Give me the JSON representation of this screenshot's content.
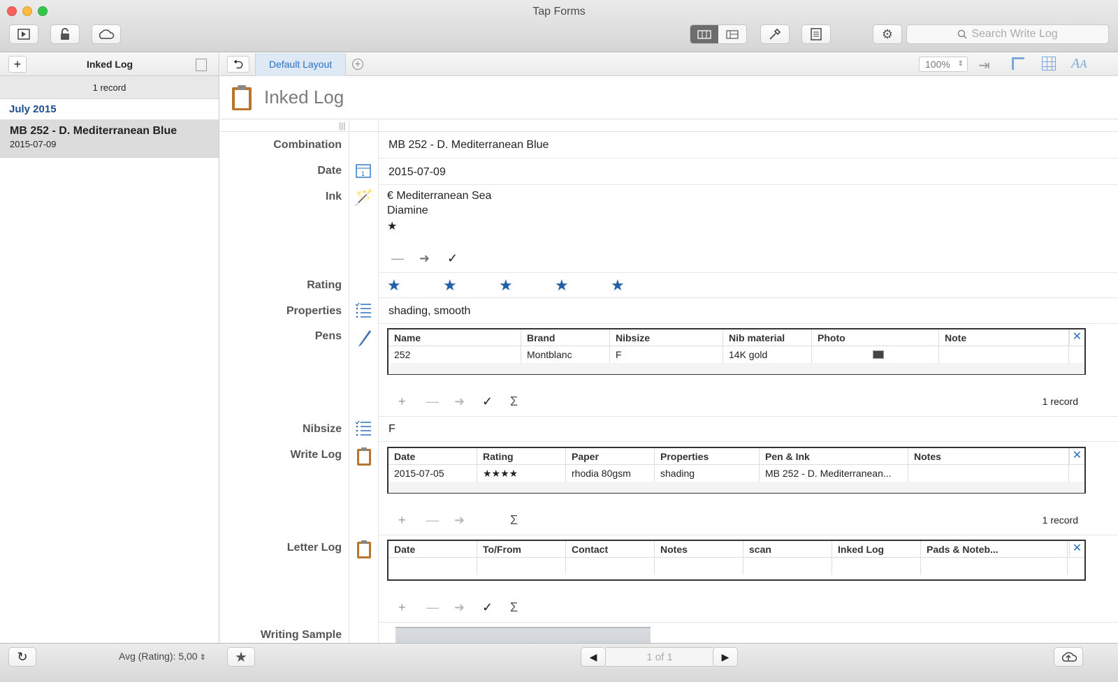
{
  "window": {
    "title": "Tap Forms",
    "search_placeholder": "Search Write Log"
  },
  "sidebar": {
    "title": "Inked Log",
    "record_count": "1 record",
    "group": "July 2015",
    "record": {
      "title": "MB 252 - D. Mediterranean Blue",
      "date": "2015-07-09"
    },
    "footer": "Avg (Rating): 5,00"
  },
  "main": {
    "layout_tab": "Default Layout",
    "zoom": "100%",
    "form_title": "Inked Log",
    "fields": {
      "combination": {
        "label": "Combination",
        "value": "MB 252 - D. Mediterranean Blue"
      },
      "date": {
        "label": "Date",
        "value": "2015-07-09"
      },
      "ink": {
        "label": "Ink",
        "line1": "€ Mediterranean Sea",
        "line2": "Diamine",
        "line3": "★"
      },
      "rating": {
        "label": "Rating",
        "value": 5,
        "max": 5
      },
      "properties": {
        "label": "Properties",
        "value": "shading, smooth"
      },
      "pens": {
        "label": "Pens"
      },
      "nibsize": {
        "label": "Nibsize",
        "value": "F"
      },
      "write_log": {
        "label": "Write Log"
      },
      "letter_log": {
        "label": "Letter Log"
      },
      "writing_sample": {
        "label": "Writing Sample"
      }
    },
    "pens_table": {
      "columns": [
        "Name",
        "Brand",
        "Nibsize",
        "Nib material",
        "Photo",
        "Note"
      ],
      "row": [
        "252",
        "Montblanc",
        "F",
        "14K gold",
        "",
        ""
      ],
      "count": "1 record"
    },
    "write_table": {
      "columns": [
        "Date",
        "Rating",
        "Paper",
        "Properties",
        "Pen & Ink",
        "Notes"
      ],
      "row": [
        "2015-07-05",
        "★★★★",
        "rhodia 80gsm",
        "shading",
        "MB 252 - D. Mediterranean...",
        ""
      ],
      "count": "1 record"
    },
    "letter_table": {
      "columns": [
        "Date",
        "To/From",
        "Contact",
        "Notes",
        "scan",
        "Inked Log",
        "Pads & Noteb..."
      ]
    }
  },
  "bottom": {
    "pager": "1 of 1"
  }
}
